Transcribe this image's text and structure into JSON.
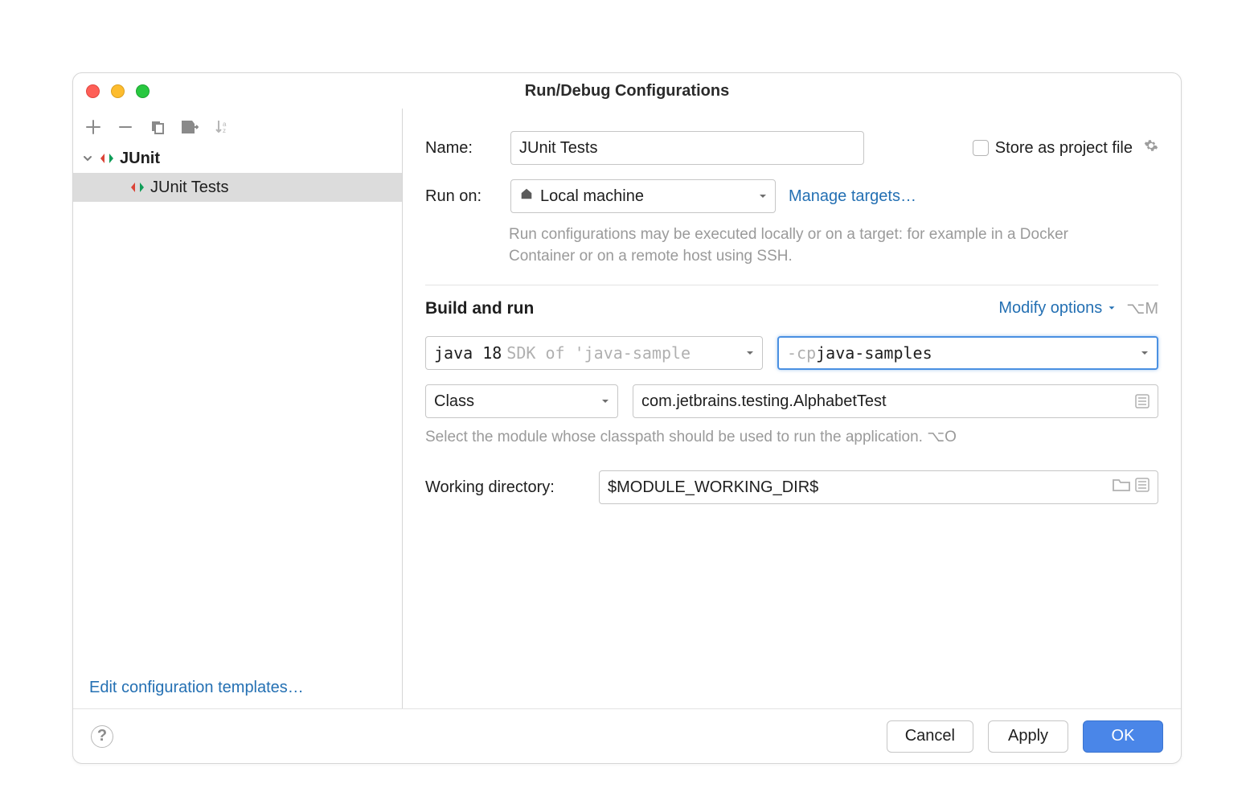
{
  "title": "Run/Debug Configurations",
  "toolbar": {
    "add": "+",
    "remove": "−"
  },
  "tree": {
    "group": "JUnit",
    "item": "JUnit Tests"
  },
  "sidebarBottomLink": "Edit configuration templates…",
  "form": {
    "nameLabel": "Name:",
    "nameValue": "JUnit Tests",
    "storeAsProjectFile": "Store as project file",
    "runOnLabel": "Run on:",
    "runOnValue": "Local machine",
    "manageTargets": "Manage targets…",
    "runOnHelp": "Run configurations may be executed locally or on a target: for example in a Docker Container or on a remote host using SSH.",
    "buildAndRun": "Build and run",
    "modifyOptions": "Modify options",
    "modifyShortcut": "⌥M",
    "jdkMain": "java 18",
    "jdkSuffix": " SDK of 'java-sample",
    "cpPrefix": "-cp ",
    "cpValue": "java-samples",
    "testKind": "Class",
    "className": "com.jetbrains.testing.AlphabetTest",
    "classHelp": "Select the module whose classpath should be used to run the application. ⌥O",
    "workingDirLabel": "Working directory:",
    "workingDirValue": "$MODULE_WORKING_DIR$"
  },
  "footer": {
    "cancel": "Cancel",
    "apply": "Apply",
    "ok": "OK"
  }
}
